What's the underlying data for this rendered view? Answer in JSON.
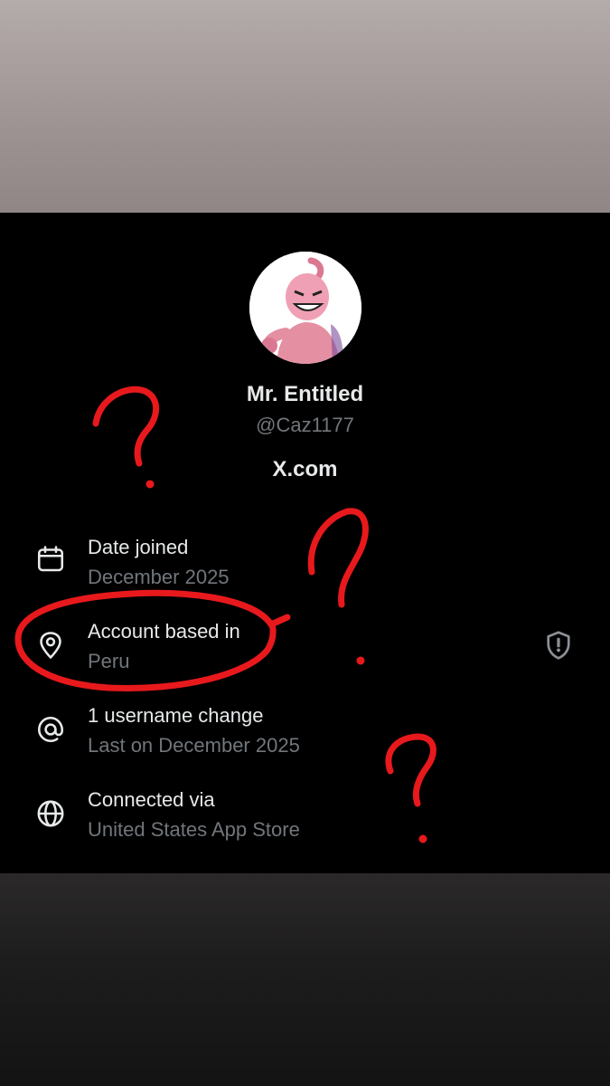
{
  "profile": {
    "display_name": "Mr. Entitled",
    "handle": "@Caz1177",
    "site": "X.com"
  },
  "details": [
    {
      "icon": "calendar-icon",
      "title": "Date joined",
      "subtitle": "December 2025"
    },
    {
      "icon": "location-pin-icon",
      "title": "Account based in",
      "subtitle": "Peru"
    },
    {
      "icon": "at-sign-icon",
      "title": "1 username change",
      "subtitle": "Last on December 2025"
    },
    {
      "icon": "globe-icon",
      "title": "Connected via",
      "subtitle": "United States App Store"
    }
  ],
  "colors": {
    "background": "#000000",
    "primary_text": "#e7e9ea",
    "secondary_text": "#71767b",
    "annotation": "#e8191c"
  }
}
